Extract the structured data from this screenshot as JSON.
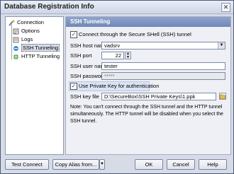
{
  "window": {
    "title": "Database Registration Info",
    "close_glyph": "✕"
  },
  "tree": {
    "items": [
      {
        "label": "Connection",
        "icon": "connection-icon"
      },
      {
        "label": "Options",
        "icon": "options-icon"
      },
      {
        "label": "Logs",
        "icon": "logs-icon"
      },
      {
        "label": "SSH Tunneling",
        "icon": "ssh-tunnel-icon",
        "selected": true
      },
      {
        "label": "HTTP Tunneling",
        "icon": "http-tunnel-icon"
      }
    ]
  },
  "panel": {
    "header": "SSH Tunneling",
    "connect_ssh_label": "Connect through the Secure SHell (SSH) tunnel",
    "ssh_host_label": "SSH host name",
    "ssh_host_value": "vadsrv",
    "ssh_port_label": "SSH port",
    "ssh_port_value": "22",
    "ssh_user_label": "SSH user name",
    "ssh_user_value": "tester",
    "ssh_password_label": "SSH password",
    "ssh_password_value": "*****",
    "use_private_key_label": "Use Private Key for authentication",
    "ssh_key_label": "SSH key file",
    "ssh_key_value": "D:\\SecureBox\\SSH Private Keys\\1.ppk",
    "note": "Note: You can't connect through the SSH tunnel and the HTTP tunnel simultaneously. The HTTP tunnel will be disabled  when you select the SSH tunnel."
  },
  "buttons": {
    "test_connect": "Test Connect",
    "copy_alias": "Copy Alias from...",
    "ok": "OK",
    "cancel": "Cancel",
    "help": "Help"
  },
  "colors": {
    "header_bg": "#7f96c4",
    "window_bg": "#d6dbe6",
    "highlight_row": "#dbe3f3"
  }
}
